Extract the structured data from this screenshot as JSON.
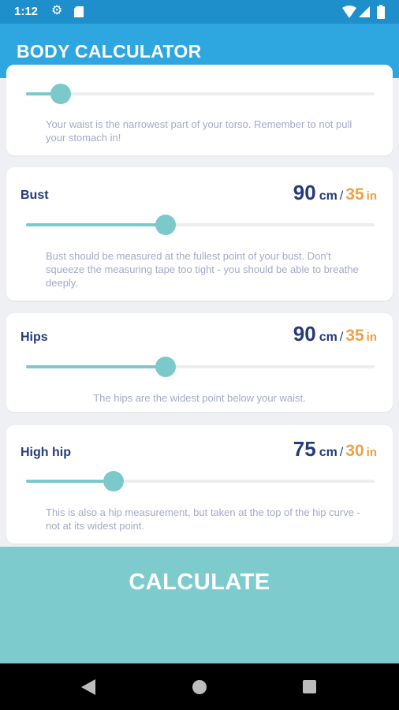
{
  "status": {
    "time": "1:12"
  },
  "app": {
    "title": "BODY CALCULATOR"
  },
  "measurements": [
    {
      "label": "",
      "cm": "",
      "inches": "",
      "slider_fraction": 0.1,
      "hint": "Your waist is the narrowest part of your torso. Remember to not pull your stomach in!"
    },
    {
      "label": "Bust",
      "cm": "90",
      "inches": "35",
      "slider_fraction": 0.4,
      "hint": "Bust should be measured at the fullest point of your bust. Don't squeeze the measuring tape too tight - you should be able to breathe deeply."
    },
    {
      "label": "Hips",
      "cm": "90",
      "inches": "35",
      "slider_fraction": 0.4,
      "hint": "The hips are the widest point below your waist."
    },
    {
      "label": "High hip",
      "cm": "75",
      "inches": "30",
      "slider_fraction": 0.25,
      "hint": "This is also a hip measurement, but taken at the top of the hip curve - not at its widest point."
    }
  ],
  "units": {
    "cm": "cm",
    "inches": "in",
    "separator": "/"
  },
  "calculate": {
    "label": "CALCULATE"
  },
  "colors": {
    "status_bar": "#1e8fca",
    "app_bar": "#2ea7e0",
    "accent_teal": "#7cc9cc",
    "label_navy": "#253a7a",
    "inch_orange": "#f2a040",
    "hint_gray": "#a4a9c8"
  },
  "icons": {
    "status": [
      "gear-icon",
      "sd-card-icon",
      "wifi-icon",
      "signal-icon",
      "battery-icon"
    ],
    "nav": [
      "back-icon",
      "home-icon",
      "recent-apps-icon"
    ]
  }
}
